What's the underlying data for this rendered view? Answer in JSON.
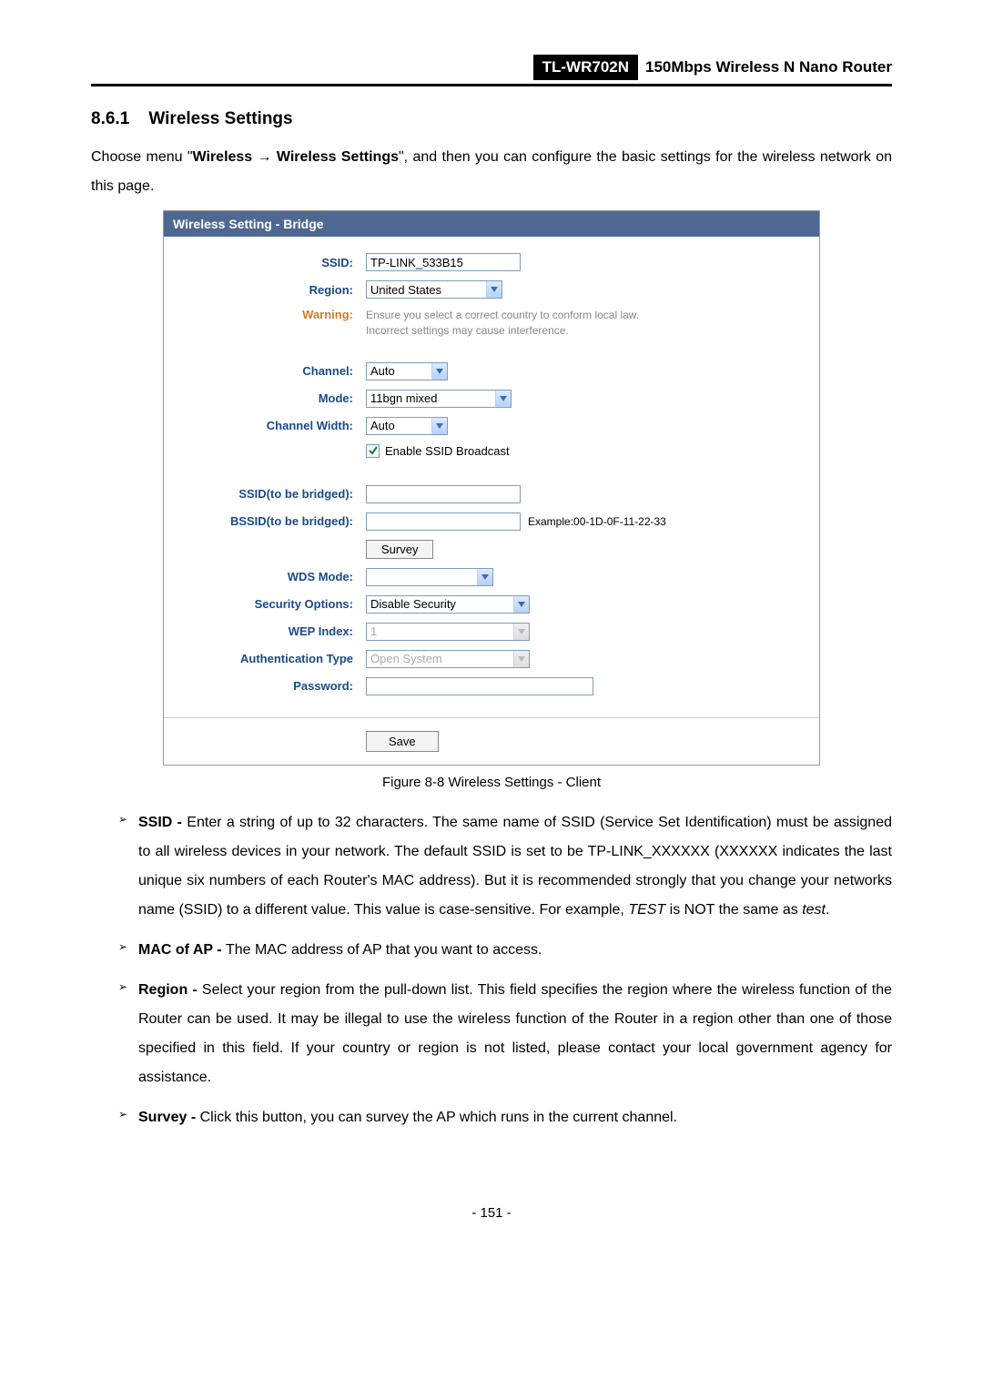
{
  "header": {
    "model": "TL-WR702N",
    "title": "150Mbps Wireless N Nano Router"
  },
  "section": {
    "number": "8.6.1",
    "title": "Wireless Settings",
    "intro_pre": "Choose menu \"",
    "intro_bold1": "Wireless",
    "intro_arrow": " → ",
    "intro_bold2": "Wireless Settings",
    "intro_post": "\", and then you can configure the basic settings for the wireless network on this page."
  },
  "figure": {
    "panel_title": "Wireless Setting - Bridge",
    "labels": {
      "ssid": "SSID:",
      "region": "Region:",
      "warning": "Warning:",
      "channel": "Channel:",
      "mode": "Mode:",
      "channel_width": "Channel Width:",
      "ssid_bridge": "SSID(to be bridged):",
      "bssid_bridge": "BSSID(to be bridged):",
      "wds_mode": "WDS Mode:",
      "security_options": "Security Options:",
      "wep_index": "WEP Index:",
      "auth_type": "Authentication Type",
      "password": "Password:"
    },
    "values": {
      "ssid": "TP-LINK_533B15",
      "region": "United States",
      "warning": "Ensure you select a correct country to conform local law. Incorrect settings may cause interference.",
      "channel": "Auto",
      "mode": "11bgn mixed",
      "channel_width": "Auto",
      "enable_ssid_broadcast": "Enable SSID Broadcast",
      "ssid_bridge": "",
      "bssid_bridge": "",
      "bssid_example": "Example:00-1D-0F-11-22-33",
      "survey_btn": "Survey",
      "wds_mode": "",
      "security_options": "Disable Security",
      "wep_index": "1",
      "auth_type": "Open System",
      "password": "",
      "save_btn": "Save"
    },
    "caption": "Figure 8-8 Wireless Settings - Client"
  },
  "bullets": {
    "ssid": {
      "term": "SSID - ",
      "text": "Enter a string of up to 32 characters. The same name of SSID (Service Set Identification) must be assigned to all wireless devices in your network. The default SSID is set to be TP-LINK_XXXXXX (XXXXXX indicates the last unique six numbers of each Router's MAC address). But it is recommended strongly that you change your networks name (SSID) to a different value. This value is case-sensitive. For example, ",
      "italic1": "TEST",
      "mid": " is NOT the same as ",
      "italic2": "test",
      "end": "."
    },
    "mac": {
      "term": "MAC of AP - ",
      "text": "The MAC address of AP that you want to access."
    },
    "region": {
      "term": "Region - ",
      "text": "Select your region from the pull-down list. This field specifies the region where the wireless function of the Router can be used. It may be illegal to use the wireless function of the Router in a region other than one of those specified in this field. If your country or region is not listed, please contact your local government agency for assistance."
    },
    "survey": {
      "term": "Survey - ",
      "text": "Click this button, you can survey the AP which runs in the current channel."
    }
  },
  "page_number": "- 151 -"
}
